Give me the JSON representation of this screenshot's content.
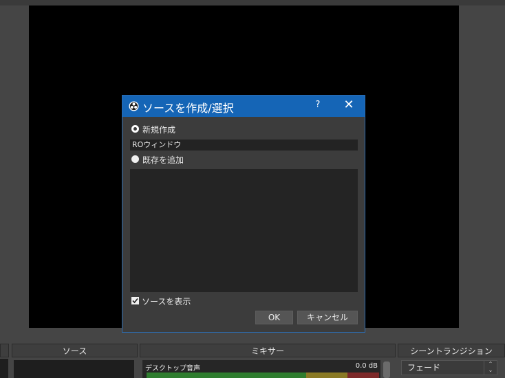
{
  "dialog": {
    "title": "ソースを作成/選択",
    "help": "?",
    "close": "✕",
    "create_new_label": "新規作成",
    "name_value": "ROウィンドウ",
    "add_existing_label": "既存を追加",
    "show_source_label": "ソースを表示",
    "ok_label": "OK",
    "cancel_label": "キャンセル"
  },
  "docks": {
    "sources_title": "ソース",
    "mixer_title": "ミキサー",
    "transitions_title": "シーントランジション"
  },
  "mixer": {
    "track_label": "デスクトップ音声",
    "level": "0.0 dB"
  },
  "transitions": {
    "selected": "フェード"
  },
  "colors": {
    "titlebar": "#1565b6",
    "dialog_bg": "#3c3c3c",
    "meter_green": "#2f7d2f",
    "meter_yellow": "#8a7a25",
    "meter_red": "#7d2a2a"
  }
}
